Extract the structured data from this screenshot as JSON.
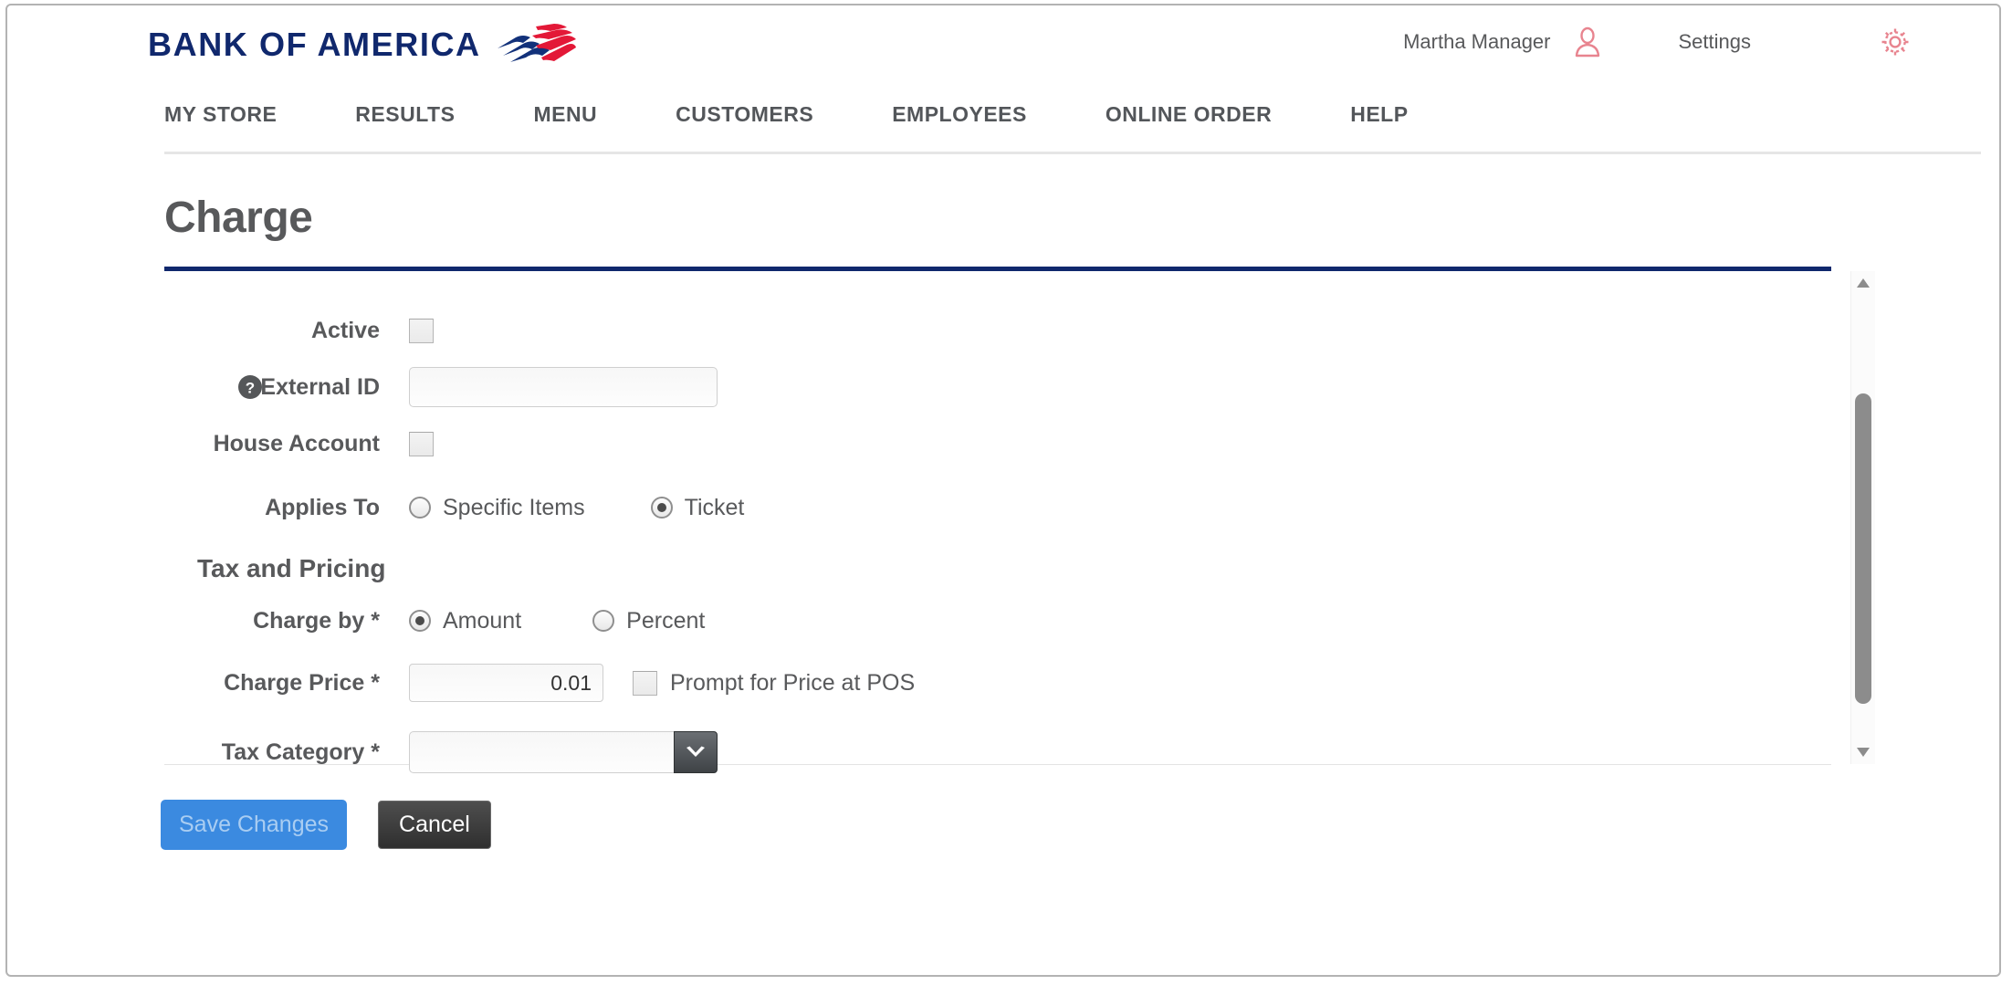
{
  "brand": {
    "wordmark": "BANK OF AMERICA",
    "flag_navy": "#12317a",
    "flag_red": "#e31837",
    "wordmark_color": "#10286d"
  },
  "header": {
    "user_name": "Martha Manager",
    "user_icon": "person-icon",
    "settings_label": "Settings",
    "settings_icon": "gear-icon",
    "icon_color": "#e8848f"
  },
  "nav": {
    "items": [
      {
        "label": "MY STORE"
      },
      {
        "label": "RESULTS"
      },
      {
        "label": "MENU"
      },
      {
        "label": "CUSTOMERS"
      },
      {
        "label": "EMPLOYEES"
      },
      {
        "label": "ONLINE ORDER"
      },
      {
        "label": "HELP"
      }
    ]
  },
  "page": {
    "title": "Charge",
    "rule_color": "#10286d"
  },
  "form": {
    "active": {
      "label": "Active",
      "checked": false
    },
    "external_id": {
      "label": "External ID",
      "value": "",
      "placeholder": "",
      "help_icon": "question-mark-icon"
    },
    "house_account": {
      "label": "House Account",
      "checked": false
    },
    "applies_to": {
      "label": "Applies To",
      "options": [
        {
          "label": "Specific Items",
          "selected": false
        },
        {
          "label": "Ticket",
          "selected": true
        }
      ]
    },
    "section_tax_and_pricing": "Tax and Pricing",
    "charge_by": {
      "label": "Charge by *",
      "options": [
        {
          "label": "Amount",
          "selected": true
        },
        {
          "label": "Percent",
          "selected": false
        }
      ]
    },
    "charge_price": {
      "label": "Charge Price *",
      "value": "0.01",
      "prompt_label": "Prompt for Price at POS",
      "prompt_checked": false
    },
    "tax_category": {
      "label": "Tax Category *",
      "value": "",
      "arrow_icon": "chevron-down-icon"
    }
  },
  "footer": {
    "save_label": "Save Changes",
    "cancel_label": "Cancel",
    "save_color": "#3b8ae0",
    "cancel_color": "#3a3a3a"
  },
  "scrollbar": {
    "up_icon": "triangle-up-icon",
    "down_icon": "triangle-down-icon"
  }
}
